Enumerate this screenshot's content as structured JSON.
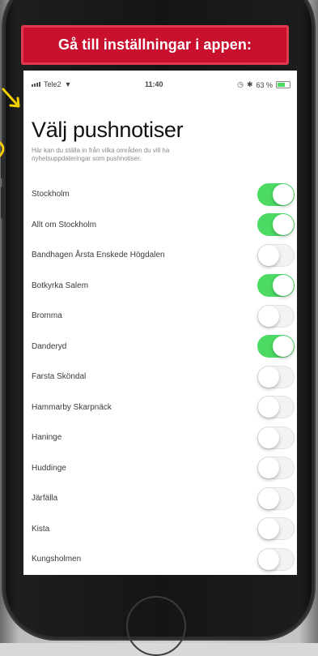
{
  "banner": {
    "text": "Gå till inställningar i appen:"
  },
  "status_bar": {
    "carrier": "Tele2",
    "time": "11:40",
    "battery": "63 %"
  },
  "page": {
    "title": "Välj pushnotiser",
    "subtitle": "Här kan du ställa in från vilka områden du vill ha nyhetsuppdateringar som pushnotiser."
  },
  "areas": [
    {
      "label": "Stockholm",
      "enabled": true
    },
    {
      "label": "Allt om Stockholm",
      "enabled": true
    },
    {
      "label": "Bandhagen Årsta Enskede Högdalen",
      "enabled": false
    },
    {
      "label": "Botkyrka Salem",
      "enabled": true
    },
    {
      "label": "Bromma",
      "enabled": false
    },
    {
      "label": "Danderyd",
      "enabled": true
    },
    {
      "label": "Farsta Sköndal",
      "enabled": false
    },
    {
      "label": "Hammarby Skarpnäck",
      "enabled": false
    },
    {
      "label": "Haninge",
      "enabled": false
    },
    {
      "label": "Huddinge",
      "enabled": false
    },
    {
      "label": "Järfälla",
      "enabled": false
    },
    {
      "label": "Kista",
      "enabled": false
    },
    {
      "label": "Kungsholmen",
      "enabled": false
    }
  ],
  "colors": {
    "banner_red": "#c8102e",
    "switch_on": "#4cd964",
    "arrow_yellow": "#f5d000"
  }
}
